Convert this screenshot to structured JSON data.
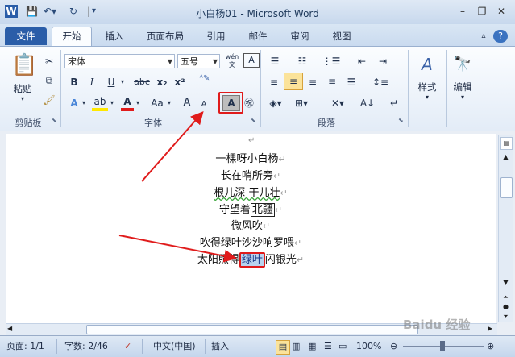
{
  "window": {
    "title": "小白杨01 - Microsoft Word",
    "controls": [
      "minimize",
      "restore",
      "close"
    ]
  },
  "tabs": [
    {
      "label": "文件",
      "file": true
    },
    {
      "label": "开始",
      "active": true
    },
    {
      "label": "插入"
    },
    {
      "label": "页面布局"
    },
    {
      "label": "引用"
    },
    {
      "label": "邮件"
    },
    {
      "label": "审阅"
    },
    {
      "label": "视图"
    }
  ],
  "ribbon": {
    "clipboard": {
      "paste_label": "粘贴",
      "group_label": "剪贴板"
    },
    "font": {
      "font_name": "宋体",
      "font_size": "五号",
      "wen_label": "wén",
      "group_label": "字体",
      "bold": "B",
      "italic": "I",
      "underline": "U",
      "strike": "abc",
      "sub": "x₂",
      "sup": "x²",
      "aa": "Aa",
      "grow": "A",
      "shrink": "A"
    },
    "paragraph": {
      "group_label": "段落"
    },
    "styles": {
      "label": "样式"
    },
    "editing": {
      "label": "编辑"
    }
  },
  "document": {
    "lines": [
      "一棵呀小白杨",
      "长在哨所旁",
      "根儿深  干儿壮",
      "守望着北疆",
      "微风吹",
      "吹得绿叶沙沙响罗喂",
      "太阳照得绿叶闪银光"
    ],
    "boxed_word": "北疆",
    "highlighted_word": "绿叶"
  },
  "status": {
    "page": "页面: 1/1",
    "words": "字数: 2/46",
    "language": "中文(中国)",
    "mode": "插入",
    "zoom": "100%"
  },
  "watermark": "Baidu 经验"
}
